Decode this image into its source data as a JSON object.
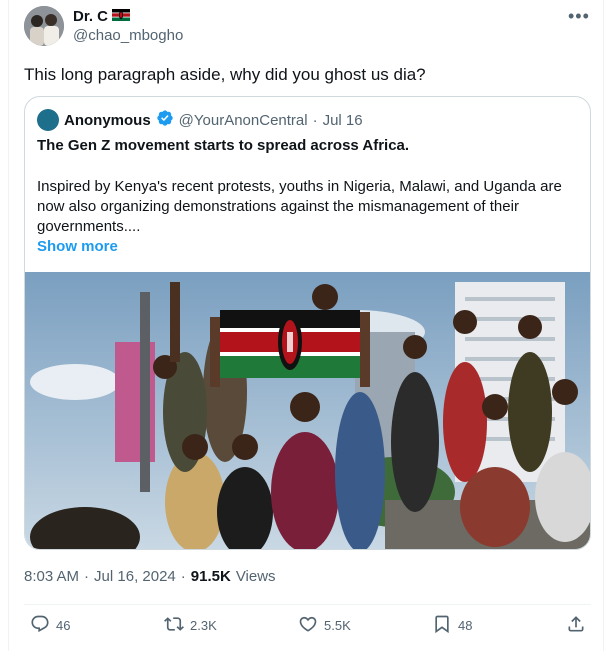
{
  "author": {
    "name": "Dr. C",
    "handle": "@chao_mbogho",
    "flag_icon": "kenya-flag-icon"
  },
  "tweet": {
    "text": "This long paragraph aside, why did you ghost us dia?"
  },
  "quote": {
    "name": "Anonymous",
    "handle": "@YourAnonCentral",
    "separator": "·",
    "date": "Jul 16",
    "title": "The Gen Z movement starts to spread across Africa.",
    "body": "Inspired by Kenya's recent protests, youths in Nigeria, Malawi, and Uganda are now also organizing demonstrations against the mismanagement of their governments....",
    "show_more": "Show more"
  },
  "meta": {
    "time": "8:03 AM",
    "separator": "·",
    "date": "Jul 16, 2024",
    "separator2": "·",
    "views_count": "91.5K",
    "views_label": "Views"
  },
  "actions": {
    "replies": "46",
    "reposts": "2.3K",
    "likes": "5.5K",
    "bookmarks": "48"
  },
  "colors": {
    "accent": "#1d9bf0",
    "secondary_text": "#536471",
    "border": "#cfd9de"
  }
}
